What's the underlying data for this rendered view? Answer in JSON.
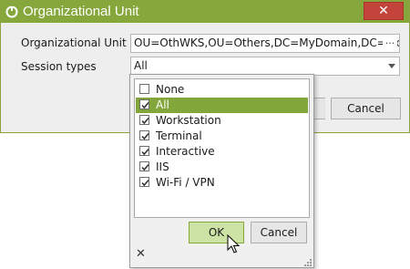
{
  "window": {
    "title": "Organizational Unit",
    "close_glyph": "✕"
  },
  "form": {
    "ou_label": "Organizational Unit",
    "ou_value": "OU=OthWKS,OU=Others,DC=MyDomain,DC=local",
    "ou_browse_glyph": "···",
    "session_label": "Session types",
    "session_value": "All"
  },
  "dialog_buttons": {
    "cancel": "Cancel"
  },
  "popup": {
    "items": [
      {
        "label": "None",
        "checked": false,
        "selected": false
      },
      {
        "label": "All",
        "checked": true,
        "selected": true
      },
      {
        "label": "Workstation",
        "checked": true,
        "selected": false
      },
      {
        "label": "Terminal",
        "checked": true,
        "selected": false
      },
      {
        "label": "Interactive",
        "checked": true,
        "selected": false
      },
      {
        "label": "IIS",
        "checked": true,
        "selected": false
      },
      {
        "label": "Wi-Fi / VPN",
        "checked": true,
        "selected": false
      }
    ],
    "ok_label": "OK",
    "cancel_label": "Cancel",
    "close_glyph": "✕"
  },
  "colors": {
    "accent": "#86a73b",
    "selection": "#82a63a",
    "close_red": "#c2443b",
    "ok_bg": "#cde3a6"
  },
  "icons": [
    "app-icon",
    "close-icon",
    "browse-icon",
    "chevron-down-icon",
    "checkbox-icon",
    "resize-grip-icon",
    "mouse-cursor-icon"
  ]
}
